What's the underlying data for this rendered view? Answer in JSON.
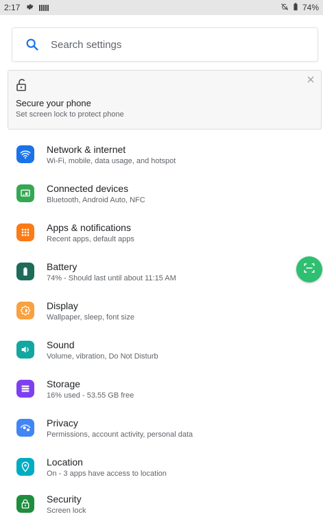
{
  "status_bar": {
    "time": "2:17",
    "battery": "74%",
    "icons": [
      "gear-icon",
      "barcode-icon",
      "mute-icon",
      "battery-icon"
    ]
  },
  "search": {
    "placeholder": "Search settings",
    "icon": "search-icon"
  },
  "suggestion_card": {
    "title": "Secure your phone",
    "subtitle": "Set screen lock to protect phone",
    "icon": "unlock-icon"
  },
  "settings_items": [
    {
      "title": "Network & internet",
      "subtitle": "Wi-Fi, mobile, data usage, and hotspot",
      "icon": "wifi-icon",
      "color": "#1a73e8"
    },
    {
      "title": "Connected devices",
      "subtitle": "Bluetooth, Android Auto, NFC",
      "icon": "devices-icon",
      "color": "#34a853"
    },
    {
      "title": "Apps & notifications",
      "subtitle": "Recent apps, default apps",
      "icon": "apps-grid-icon",
      "color": "#fa7b17"
    },
    {
      "title": "Battery",
      "subtitle": "74% - Should last until about 11:15 AM",
      "icon": "battery-icon",
      "color": "#1e6b5a"
    },
    {
      "title": "Display",
      "subtitle": "Wallpaper, sleep, font size",
      "icon": "brightness-icon",
      "color": "#f9a03f"
    },
    {
      "title": "Sound",
      "subtitle": "Volume, vibration, Do Not Disturb",
      "icon": "volume-icon",
      "color": "#12a7a0"
    },
    {
      "title": "Storage",
      "subtitle": "16% used - 53.55 GB free",
      "icon": "storage-icon",
      "color": "#7e3ff2"
    },
    {
      "title": "Privacy",
      "subtitle": "Permissions, account activity, personal data",
      "icon": "eye-lock-icon",
      "color": "#4285f4"
    },
    {
      "title": "Location",
      "subtitle": "On - 3 apps have access to location",
      "icon": "location-pin-icon",
      "color": "#00acc1"
    },
    {
      "title": "Security",
      "subtitle": "Screen lock",
      "icon": "lock-icon",
      "color": "#1e8e3e"
    }
  ],
  "floating_button": {
    "icon": "scan-icon",
    "color": "#2fbf71"
  }
}
